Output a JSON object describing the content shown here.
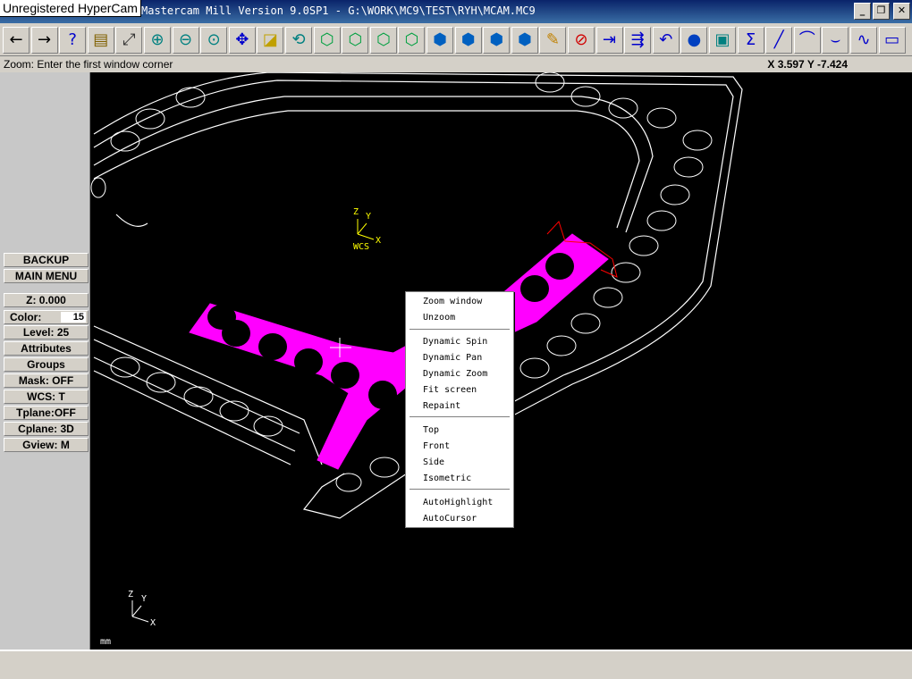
{
  "window": {
    "watermark": "Unregistered HyperCam",
    "title": "Mastercam Mill Version 9.0SP1 - G:\\WORK\\MC9\\TEST\\RYH\\MCAM.MC9",
    "minimize": "_",
    "maximize": "❐",
    "close": "✕"
  },
  "toolbar": {
    "icons": [
      "back-arrow-icon",
      "forward-arrow-icon",
      "help-icon",
      "clipboard-icon",
      "analyze-icon",
      "zoom-icon",
      "zoom-out-icon",
      "zoom-fit-icon",
      "pan-icon",
      "select-icon",
      "rotate-view-icon",
      "cube-top-icon",
      "cube-front-icon",
      "cube-side-icon",
      "cube-iso-icon",
      "cube-blue1-icon",
      "cube-blue2-icon",
      "cube-blue3-icon",
      "cube-blue4-icon",
      "pencil-icon",
      "delete-icon",
      "transform-icon",
      "multi-transform-icon",
      "undo-icon",
      "shade-sphere-icon",
      "layers-icon",
      "sum-icon",
      "line-icon",
      "arc-icon",
      "fillet-icon",
      "spline-icon",
      "rectangle-icon"
    ]
  },
  "prompt": {
    "text": "Zoom: Enter the first window corner",
    "coords": "X 3.597   Y -7.424"
  },
  "menu": {
    "backup": "BACKUP",
    "main_menu": "MAIN MENU",
    "z": "Z:  0.000",
    "color_label": "Color:",
    "color_value": "15",
    "level": "Level: 25",
    "attributes": "Attributes",
    "groups": "Groups",
    "mask": "Mask:  OFF",
    "wcs": "WCS:   T",
    "tplane": "Tplane:OFF",
    "cplane": "Cplane: 3D",
    "gview": "Gview:   M"
  },
  "viewport": {
    "wcs_z": "Z",
    "wcs_y": "Y",
    "wcs_x": "X",
    "wcs_label": "WCS",
    "axis_z": "Z",
    "axis_y": "Y",
    "axis_x": "X",
    "units": "mm",
    "geometry_color": "#ffffff",
    "selected_color": "#ff00ff"
  },
  "context_menu": {
    "items": [
      "Zoom window",
      "Unzoom",
      "Dynamic Spin",
      "Dynamic Pan",
      "Dynamic Zoom",
      "Fit screen",
      "Repaint",
      "Top",
      "Front",
      "Side",
      "Isometric",
      "AutoHighlight",
      "AutoCursor"
    ]
  }
}
